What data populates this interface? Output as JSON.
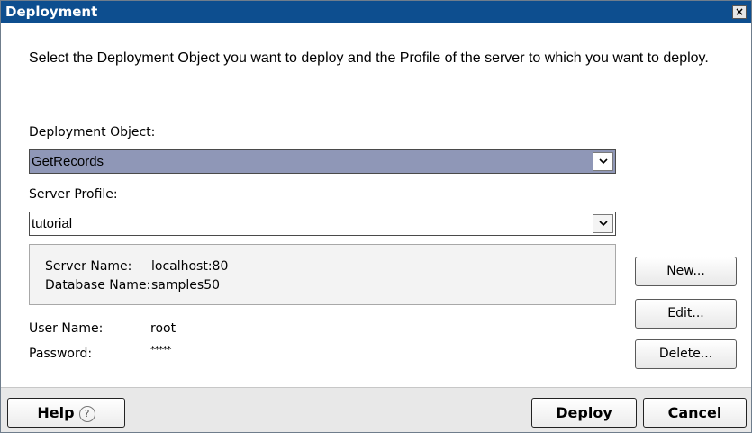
{
  "window": {
    "title": "Deployment",
    "close_label": "×"
  },
  "instructions": "Select the Deployment Object you want to deploy and the Profile of the server to which you want to deploy.",
  "deployment_object": {
    "label": "Deployment Object:",
    "value": "GetRecords"
  },
  "server_profile": {
    "label": "Server Profile:",
    "value": "tutorial"
  },
  "server_info": {
    "server_name_label": "Server Name:",
    "server_name_value": "localhost:80",
    "database_name_label": "Database Name:",
    "database_name_value": "samples50"
  },
  "user": {
    "user_name_label": "User Name:",
    "user_name_value": "root",
    "password_label": "Password:",
    "password_value": "*****"
  },
  "side_buttons": {
    "new": "New...",
    "edit": "Edit...",
    "delete": "Delete..."
  },
  "footer": {
    "help": "Help",
    "help_icon": "?",
    "deploy": "Deploy",
    "cancel": "Cancel"
  },
  "colors": {
    "titlebar": "#0d4e8f",
    "selected_combo": "#8f97b7"
  }
}
